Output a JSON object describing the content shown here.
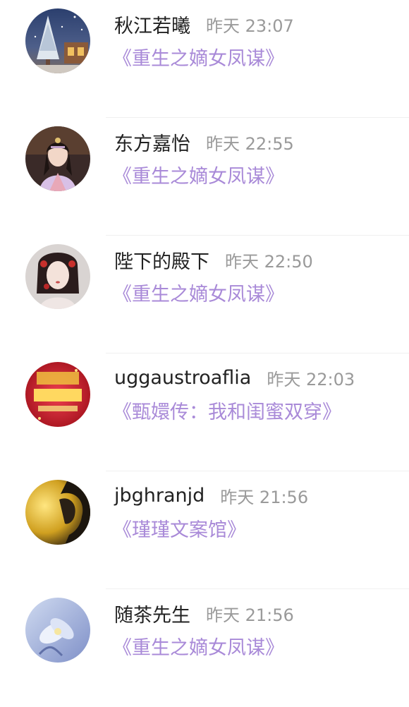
{
  "comments": [
    {
      "name": "秋江若曦",
      "time": "昨天 23:07",
      "title": "《重生之嫡女凤谋》",
      "avatar": "winter-snow-christmas-tree-avatar"
    },
    {
      "name": "东方嘉怡",
      "time": "昨天 22:55",
      "title": "《重生之嫡女凤谋》",
      "avatar": "hanfu-girl-avatar"
    },
    {
      "name": "陛下的殿下",
      "time": "昨天 22:50",
      "title": "《重生之嫡女凤谋》",
      "avatar": "girl-with-red-hair-ornaments-avatar"
    },
    {
      "name": "uggaustroaflia",
      "time": "昨天 22:03",
      "title": "《甄嬛传：我和闺蜜双穿》",
      "avatar": "red-2014-greeting-card-avatar"
    },
    {
      "name": "jbghranjd",
      "time": "昨天 21:56",
      "title": "《瑾瑾文案馆》",
      "avatar": "boy-silhouette-golden-light-avatar"
    },
    {
      "name": "随茶先生",
      "time": "昨天 21:56",
      "title": "《重生之嫡女凤谋》",
      "avatar": "blue-flowers-avatar"
    }
  ],
  "colors": {
    "accent": "#a98ad8",
    "name": "#222222",
    "time": "#9a9a9a"
  }
}
